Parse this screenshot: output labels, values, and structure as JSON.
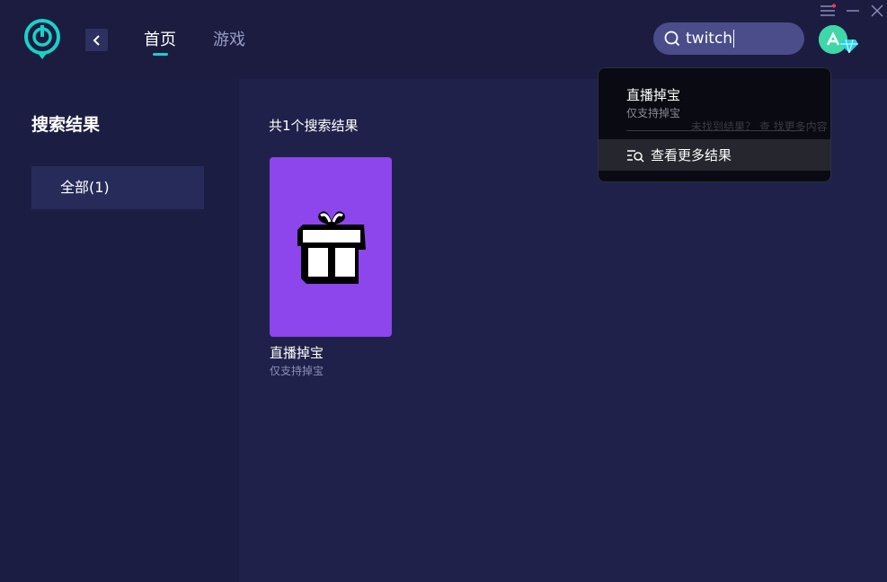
{
  "header": {
    "nav": {
      "home": "首页",
      "games": "游戏"
    },
    "search": {
      "value": "twitch"
    }
  },
  "sidebar": {
    "title": "搜索结果",
    "filters": [
      {
        "label": "全部(1)"
      }
    ]
  },
  "main": {
    "result_count": "共1个搜索结果",
    "results": [
      {
        "name": "直播掉宝",
        "subtitle": "仅支持掉宝",
        "icon": "gift-icon",
        "color": "#8c46eb"
      }
    ]
  },
  "dropdown": {
    "items": [
      {
        "name": "直播掉宝",
        "subtitle": "仅支持掉宝"
      }
    ],
    "more_label": "查看更多结果"
  },
  "colors": {
    "accent": "#1ad1c8",
    "background": "#1e1f45",
    "card": "#8c46eb"
  }
}
